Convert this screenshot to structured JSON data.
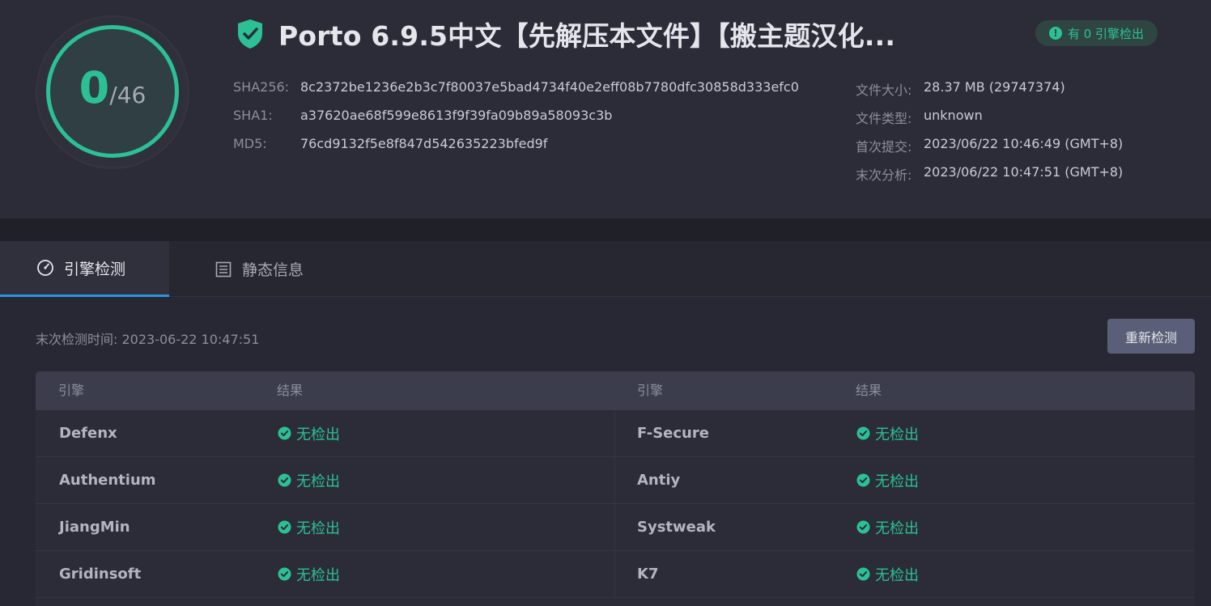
{
  "score": {
    "detected": "0",
    "total": "/46"
  },
  "file": {
    "title": "Porto 6.9.5中文【先解压本文件】【搬主题汉化...",
    "badge": "有 0 引擎检出"
  },
  "hashes": [
    {
      "label": "SHA256:",
      "value": "8c2372be1236e2b3c7f80037e5bad4734f40e2eff08b7780dfc30858d333efc0"
    },
    {
      "label": "SHA1:",
      "value": "a37620ae68f599e8613f9f39fa09b89a58093c3b"
    },
    {
      "label": "MD5:",
      "value": "76cd9132f5e8f847d542635223bfed9f"
    }
  ],
  "meta": [
    {
      "label": "文件大小:",
      "value": "28.37 MB (29747374)"
    },
    {
      "label": "文件类型:",
      "value": "unknown"
    },
    {
      "label": "首次提交:",
      "value": "2023/06/22 10:46:49 (GMT+8)"
    },
    {
      "label": "末次分析:",
      "value": "2023/06/22 10:47:51 (GMT+8)"
    }
  ],
  "tabs": [
    {
      "label": "引擎检测",
      "icon": "gauge-icon",
      "active": true
    },
    {
      "label": "静态信息",
      "icon": "document-list-icon",
      "active": false
    }
  ],
  "content": {
    "last_check": "末次检测时间: 2023-06-22 10:47:51",
    "rescan_label": "重新检测"
  },
  "table": {
    "headers": [
      "引擎",
      "结果",
      "引擎",
      "结果"
    ],
    "rows": [
      [
        {
          "engine": "Defenx",
          "result": "无检出"
        },
        {
          "engine": "F-Secure",
          "result": "无检出"
        }
      ],
      [
        {
          "engine": "Authentium",
          "result": "无检出"
        },
        {
          "engine": "Antiy",
          "result": "无检出"
        }
      ],
      [
        {
          "engine": "JiangMin",
          "result": "无检出"
        },
        {
          "engine": "Systweak",
          "result": "无检出"
        }
      ],
      [
        {
          "engine": "Gridinsoft",
          "result": "无检出"
        },
        {
          "engine": "K7",
          "result": "无检出"
        }
      ]
    ]
  },
  "colors": {
    "accent_green": "#2bc195",
    "tab_underline": "#2a94de",
    "background": "#272833"
  }
}
